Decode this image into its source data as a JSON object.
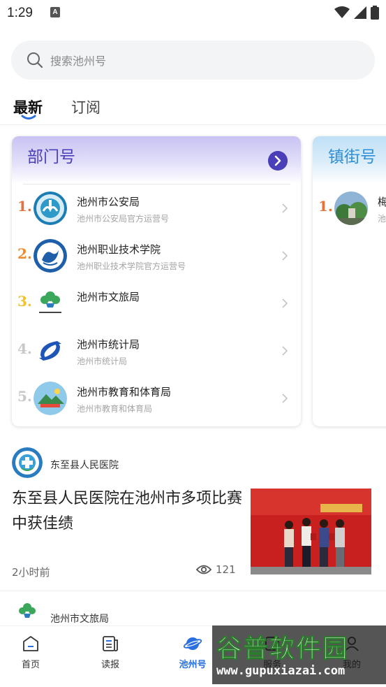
{
  "status_bar": {
    "time": "1:29",
    "notification_icon": "A"
  },
  "search": {
    "placeholder": "搜索池州号"
  },
  "tabs": [
    {
      "label": "最新",
      "active": true
    },
    {
      "label": "订阅",
      "active": false
    }
  ],
  "dept_card": {
    "title": "部门号",
    "items": [
      {
        "rank": "1.",
        "rank_color": "#e8703a",
        "name": "池州市公安局",
        "desc": "池州市公安局官方运营号"
      },
      {
        "rank": "2.",
        "rank_color": "#f08a2e",
        "name": "池州职业技术学院",
        "desc": "池州职业技术学院官方运营号"
      },
      {
        "rank": "3.",
        "rank_color": "#f3c22a",
        "name": "池州市文旅局",
        "desc": ""
      },
      {
        "rank": "4.",
        "rank_color": "#c8c8c8",
        "name": "池州市统计局",
        "desc": "池州市统计局"
      },
      {
        "rank": "5.",
        "rank_color": "#c8c8c8",
        "name": "池州市教育和体育局",
        "desc": "池州市教育和体育局"
      }
    ]
  },
  "town_card": {
    "title": "镇街号",
    "items": [
      {
        "rank": "1.",
        "rank_color": "#e8703a",
        "name": "梅",
        "desc": "池"
      }
    ]
  },
  "article": {
    "source": "东至县人民医院",
    "title": "东至县人民医院在池州市多项比赛中获佳绩",
    "time": "2小时前",
    "views": "121"
  },
  "next_article": {
    "source": "池州市文旅局"
  },
  "bottom_nav": [
    {
      "label": "首页",
      "icon": "home-icon",
      "active": false
    },
    {
      "label": "读报",
      "icon": "newspaper-icon",
      "active": false
    },
    {
      "label": "池州号",
      "icon": "planet-icon",
      "active": true
    },
    {
      "label": "服务",
      "icon": "service-icon",
      "active": false
    },
    {
      "label": "我的",
      "icon": "profile-icon",
      "active": false
    }
  ],
  "watermark": {
    "main": "谷普软件园",
    "sub": "www.gupuxiazai.com"
  },
  "colors": {
    "accent": "#2a6fe0",
    "dept_title": "#4a3fb9",
    "town_title": "#2f8fd8"
  }
}
